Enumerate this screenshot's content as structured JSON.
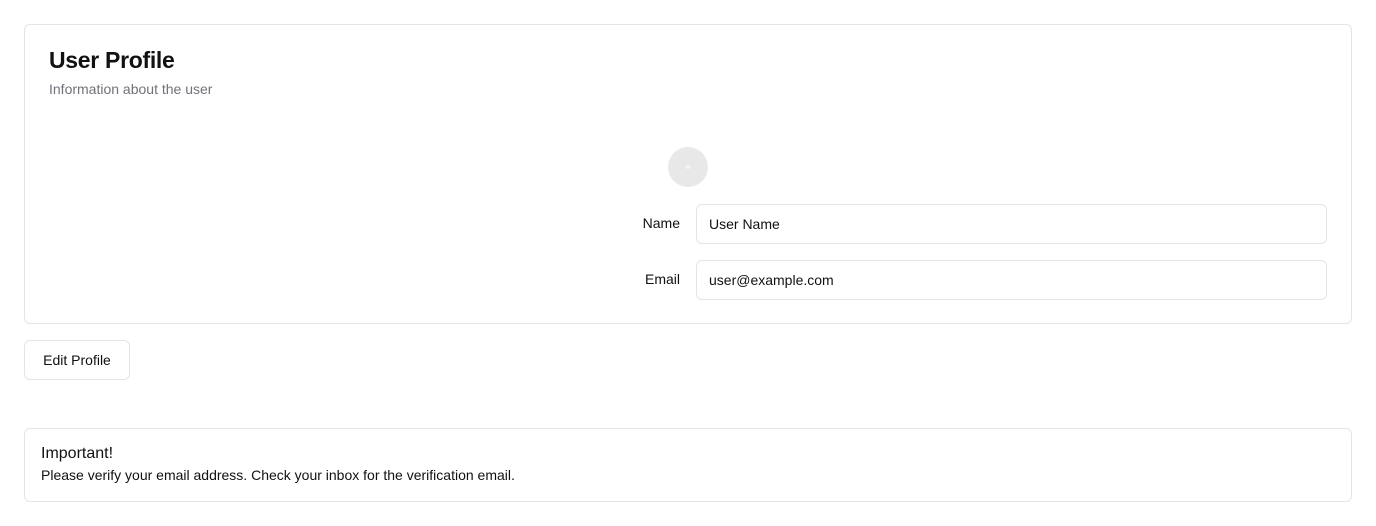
{
  "profile_card": {
    "title": "User Profile",
    "subtitle": "Information about the user",
    "avatar_icon": "user-avatar-placeholder",
    "fields": {
      "name": {
        "label": "Name",
        "value": "User Name"
      },
      "email": {
        "label": "Email",
        "value": "user@example.com"
      }
    }
  },
  "actions": {
    "edit_label": "Edit Profile"
  },
  "alert": {
    "title": "Important!",
    "description": "Please verify your email address. Check your inbox for the verification email."
  },
  "colors": {
    "border": "#e4e4e7",
    "muted_text": "#71717a",
    "avatar_bg": "#e8e8e8"
  }
}
